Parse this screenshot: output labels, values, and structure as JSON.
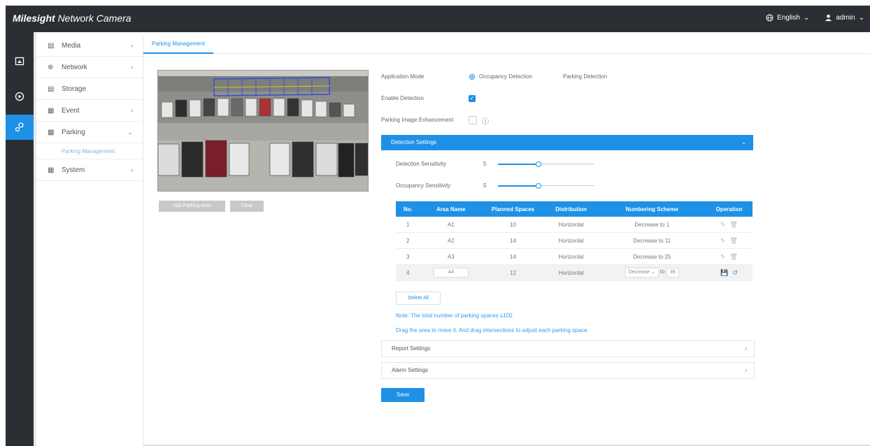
{
  "brand": {
    "logo_text": "Milesight",
    "product": "Network Camera"
  },
  "header": {
    "language": "English",
    "user": "admin"
  },
  "icon_nav": [
    "live-view-icon",
    "playback-icon",
    "settings-icon"
  ],
  "sidebar": {
    "items": [
      {
        "label": "Media",
        "icon": "media-icon"
      },
      {
        "label": "Network",
        "icon": "network-icon"
      },
      {
        "label": "Storage",
        "icon": "storage-icon"
      },
      {
        "label": "Event",
        "icon": "event-icon"
      },
      {
        "label": "Parking",
        "icon": "parking-icon"
      },
      {
        "label": "System",
        "icon": "system-icon"
      }
    ],
    "sub_item": "Parking Management"
  },
  "tab": "Parking Management",
  "camera": {
    "add_area_label": "Add Parking Area",
    "clear_label": "Clear"
  },
  "settings": {
    "application_mode_label": "Application Mode",
    "mode_occupancy": "Occupancy Detection",
    "mode_parking": "Parking Detection",
    "enable_detection_label": "Enable Detection",
    "enhancement_label": "Parking Image Enhancement"
  },
  "detection": {
    "title": "Detection Settings",
    "sensitivity_label": "Detection Sensitivity",
    "sensitivity_value": "5",
    "occupancy_label": "Occupancy Sensitivity",
    "occupancy_value": "5"
  },
  "table": {
    "headers": [
      "No.",
      "Area Name",
      "Planned Spaces",
      "Distribution",
      "Numbering Scheme",
      "Operation"
    ],
    "rows": [
      {
        "no": "1",
        "area": "A1",
        "spaces": "10",
        "dist": "Horizontal",
        "scheme": "Decrease to 1"
      },
      {
        "no": "2",
        "area": "A2",
        "spaces": "14",
        "dist": "Horizontal",
        "scheme": "Decrease to 11"
      },
      {
        "no": "3",
        "area": "A3",
        "spaces": "14",
        "dist": "Horizontal",
        "scheme": "Decrease to 25"
      }
    ],
    "edit_row": {
      "no": "4",
      "area": "A4",
      "spaces": "12",
      "dist": "Horizontal",
      "scheme_select": "Decrease",
      "to_label": "to",
      "to_value": "39"
    }
  },
  "delete_all_label": "Delete All",
  "note1": "Note: The total number of parking spaces ≤100",
  "note2": "Drag the area to move it. And drag intersections to adjust each parking space.",
  "report_settings_label": "Report Settings",
  "alarm_settings_label": "Alarm Settings",
  "save_label": "Save"
}
